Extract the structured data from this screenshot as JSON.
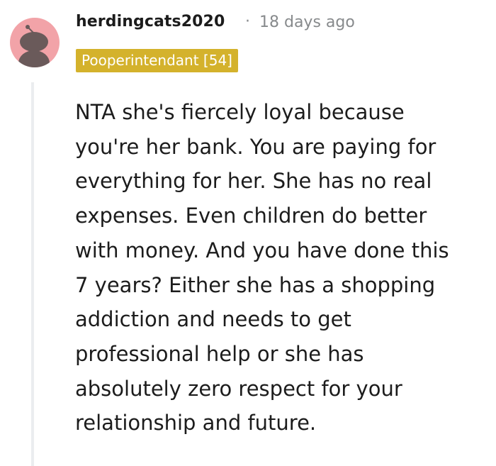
{
  "comment": {
    "author": "herdingcats2020",
    "separator": "·",
    "timestamp": "18 days ago",
    "flair": "Pooperintendant [54]",
    "body_lines": [
      "NTA she's fiercely loyal because",
      "you're her bank. You are paying for",
      "everything for her. She has no real",
      "expenses. Even children do better",
      "with money. And you have done this",
      "7 years? Either she has a shopping",
      "addiction and needs to get",
      "professional help or she has",
      "absolutely zero respect for your",
      "relationship and future."
    ]
  },
  "colors": {
    "avatar_bg": "#f2a3a8",
    "avatar_figure": "#6a5a5a",
    "flair_bg": "#d4b22c",
    "flair_text": "#ffffff",
    "meta_text": "#878a8c",
    "thread_line": "#ebedef"
  },
  "icons": {
    "avatar": "snoo-avatar-icon"
  }
}
